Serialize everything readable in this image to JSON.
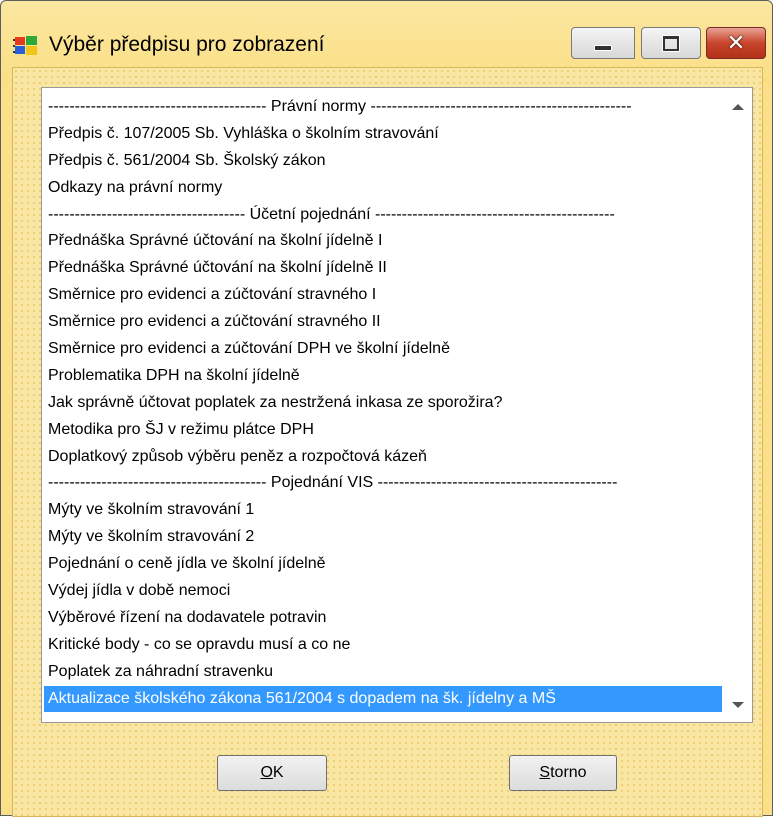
{
  "window": {
    "title": "Výběr předpisu pro zobrazení",
    "icon": "app-windows-icon",
    "controls": [
      "minimize-icon",
      "maximize-icon",
      "close-icon"
    ]
  },
  "list": {
    "items": [
      {
        "text": "----------------------------------------- Právní normy -------------------------------------------------",
        "selected": false
      },
      {
        "text": "Předpis č. 107/2005 Sb. Vyhláška o školním stravování",
        "selected": false
      },
      {
        "text": "Předpis č. 561/2004 Sb. Školský zákon",
        "selected": false
      },
      {
        "text": "Odkazy na právní normy",
        "selected": false
      },
      {
        "text": "------------------------------------- Účetní pojednání ---------------------------------------------",
        "selected": false
      },
      {
        "text": "Přednáška Správné účtování na školní jídelně I",
        "selected": false
      },
      {
        "text": "Přednáška Správné účtování na školní jídelně II",
        "selected": false
      },
      {
        "text": "Směrnice pro evidenci a zúčtování stravného I",
        "selected": false
      },
      {
        "text": "Směrnice pro evidenci a zúčtování stravného II",
        "selected": false
      },
      {
        "text": "Směrnice pro evidenci a zúčtování DPH ve školní jídelně",
        "selected": false
      },
      {
        "text": "Problematika DPH na školní jídelně",
        "selected": false
      },
      {
        "text": "Jak správně účtovat poplatek za nestržená inkasa ze sporožira?",
        "selected": false
      },
      {
        "text": "Metodika pro ŠJ v režimu plátce DPH",
        "selected": false
      },
      {
        "text": "Doplatkový způsob výběru peněz a rozpočtová kázeň",
        "selected": false
      },
      {
        "text": "----------------------------------------- Pojednání VIS ---------------------------------------------",
        "selected": false
      },
      {
        "text": "Mýty ve školním stravování 1",
        "selected": false
      },
      {
        "text": "Mýty ve školním stravování 2",
        "selected": false
      },
      {
        "text": "Pojednání o ceně jídla ve školní jídelně",
        "selected": false
      },
      {
        "text": "Výdej jídla v době nemoci",
        "selected": false
      },
      {
        "text": "Výběrové řízení na dodavatele potravin",
        "selected": false
      },
      {
        "text": "Kritické body - co se opravdu musí a co ne",
        "selected": false
      },
      {
        "text": "Poplatek za náhradní stravenku",
        "selected": false
      },
      {
        "text": "Aktualizace školského zákona 561/2004 s dopadem na šk. jídelny a MŠ",
        "selected": true
      }
    ]
  },
  "buttons": {
    "ok": {
      "mnemonic": "O",
      "rest": "K"
    },
    "storno": {
      "mnemonic": "S",
      "rest": "torno"
    }
  },
  "colors": {
    "window_background": "#fbe089",
    "selection": "#3399ff",
    "close_button": "#c8442c"
  }
}
